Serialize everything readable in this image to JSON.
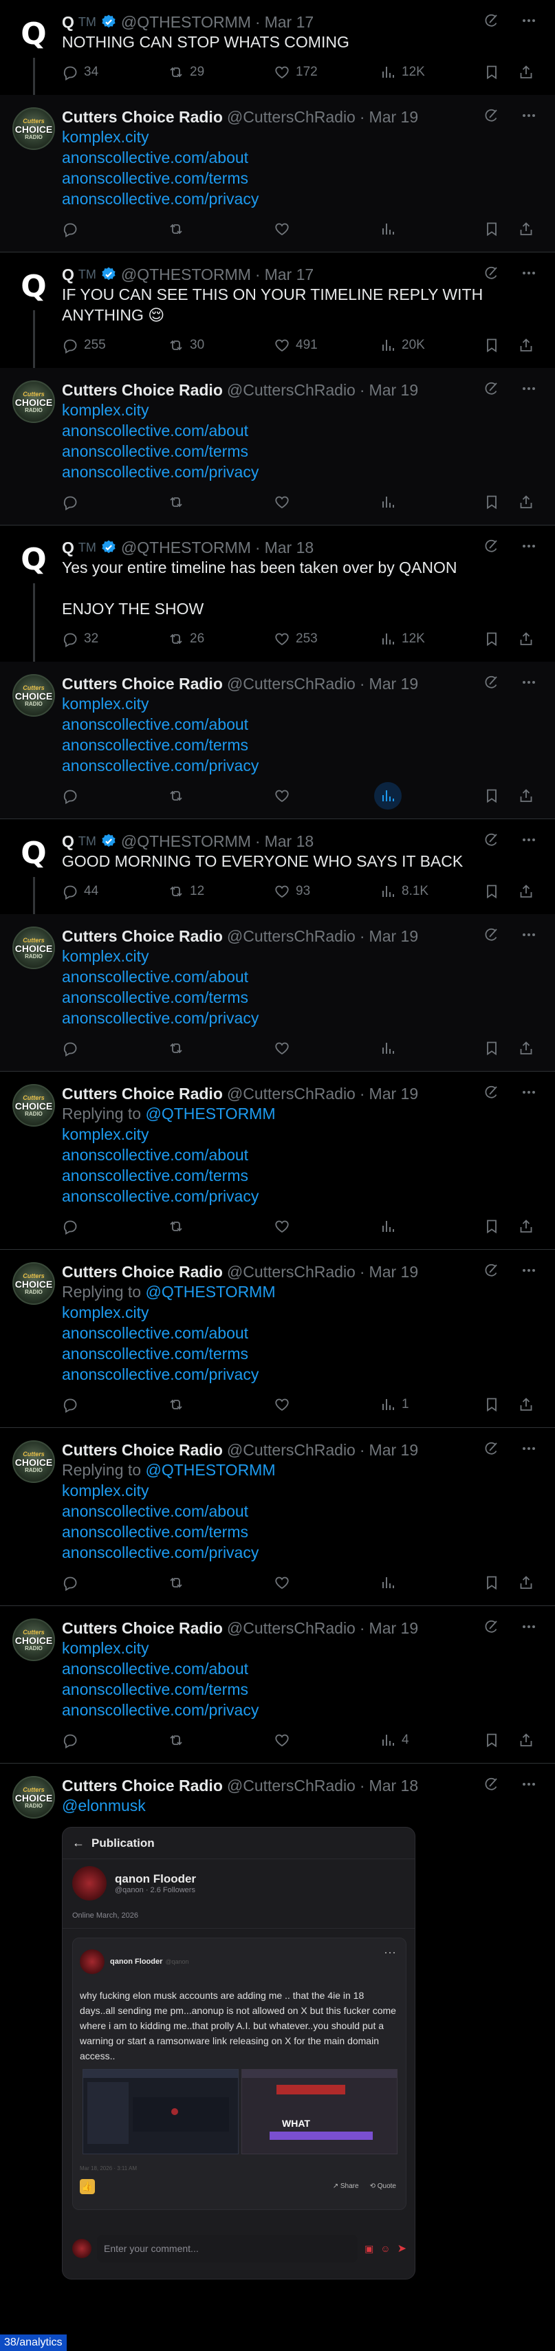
{
  "qq": {
    "name": "Q",
    "tm": "TM",
    "handle": "@QTHESTORMM"
  },
  "cc": {
    "name": "Cutters Choice Radio",
    "handle": "@CuttersChRadio",
    "avatar_line1": "Cutters",
    "avatar_line2": "CHOICE",
    "avatar_line3": "RADIO"
  },
  "links": [
    "komplex.city",
    "anonscollective.com/about",
    "anonscollective.com/terms",
    "anonscollective.com/privacy"
  ],
  "threads": [
    {
      "q_date": "Mar 17",
      "q_text": "NOTHING CAN STOP WHATS COMING",
      "q_stats": {
        "replies": "34",
        "reposts": "29",
        "likes": "172",
        "views": "12K"
      },
      "r_date": "Mar 19",
      "r_views": ""
    },
    {
      "q_date": "Mar 17",
      "q_text": "IF YOU CAN SEE THIS ON YOUR TIMELINE REPLY WITH ANYTHING 😌",
      "q_stats": {
        "replies": "255",
        "reposts": "30",
        "likes": "491",
        "views": "20K"
      },
      "r_date": "Mar 19",
      "r_views": ""
    },
    {
      "q_date": "Mar 18",
      "q_text": "Yes your entire timeline has been taken over by QANON\n\nENJOY THE SHOW",
      "q_stats": {
        "replies": "32",
        "reposts": "26",
        "likes": "253",
        "views": "12K"
      },
      "r_date": "Mar 19",
      "r_views": ""
    },
    {
      "q_date": "Mar 18",
      "q_text": "GOOD MORNING TO EVERYONE WHO SAYS IT BACK",
      "q_stats": {
        "replies": "44",
        "reposts": "12",
        "likes": "93",
        "views": "8.1K"
      },
      "r_date": "Mar 19",
      "r_views": ""
    }
  ],
  "singles": [
    {
      "date": "Mar 19",
      "replying": "Replying to",
      "mention": "@QTHESTORMM",
      "views": ""
    },
    {
      "date": "Mar 19",
      "replying": "Replying to",
      "mention": "@QTHESTORMM",
      "views": "1"
    },
    {
      "date": "Mar 19",
      "replying": "Replying to",
      "mention": "@QTHESTORMM",
      "views": ""
    },
    {
      "date": "Mar 19",
      "replying": "",
      "mention": "",
      "views": "4"
    }
  ],
  "last": {
    "date": "Mar 18",
    "mention": "@elonmusk"
  },
  "card": {
    "header": "Publication",
    "pub_name": "qanon Flooder",
    "pub_handle": "@qanon",
    "followers": "2.6 Followers",
    "online": "Online March, 2026",
    "post_author": "qanon Flooder",
    "post_handle": "@qanon",
    "post_text": "why fucking elon musk accounts are adding me .. that the 4ie in 18 days..all sending me pm...anonup is not allowed on X but this fucker come where i am to kidding me..that prolly A.I. but whatever..you should put a warning or start a ramsonware link releasing on X for the main domain access..",
    "post_date": "Mar 18, 2026 · 3:11 AM",
    "share": "Share",
    "quote": "Quote",
    "comment_placeholder": "Enter your comment...",
    "screenshot_word": "WHAT",
    "more": "···"
  },
  "status_bar": "38/analytics"
}
